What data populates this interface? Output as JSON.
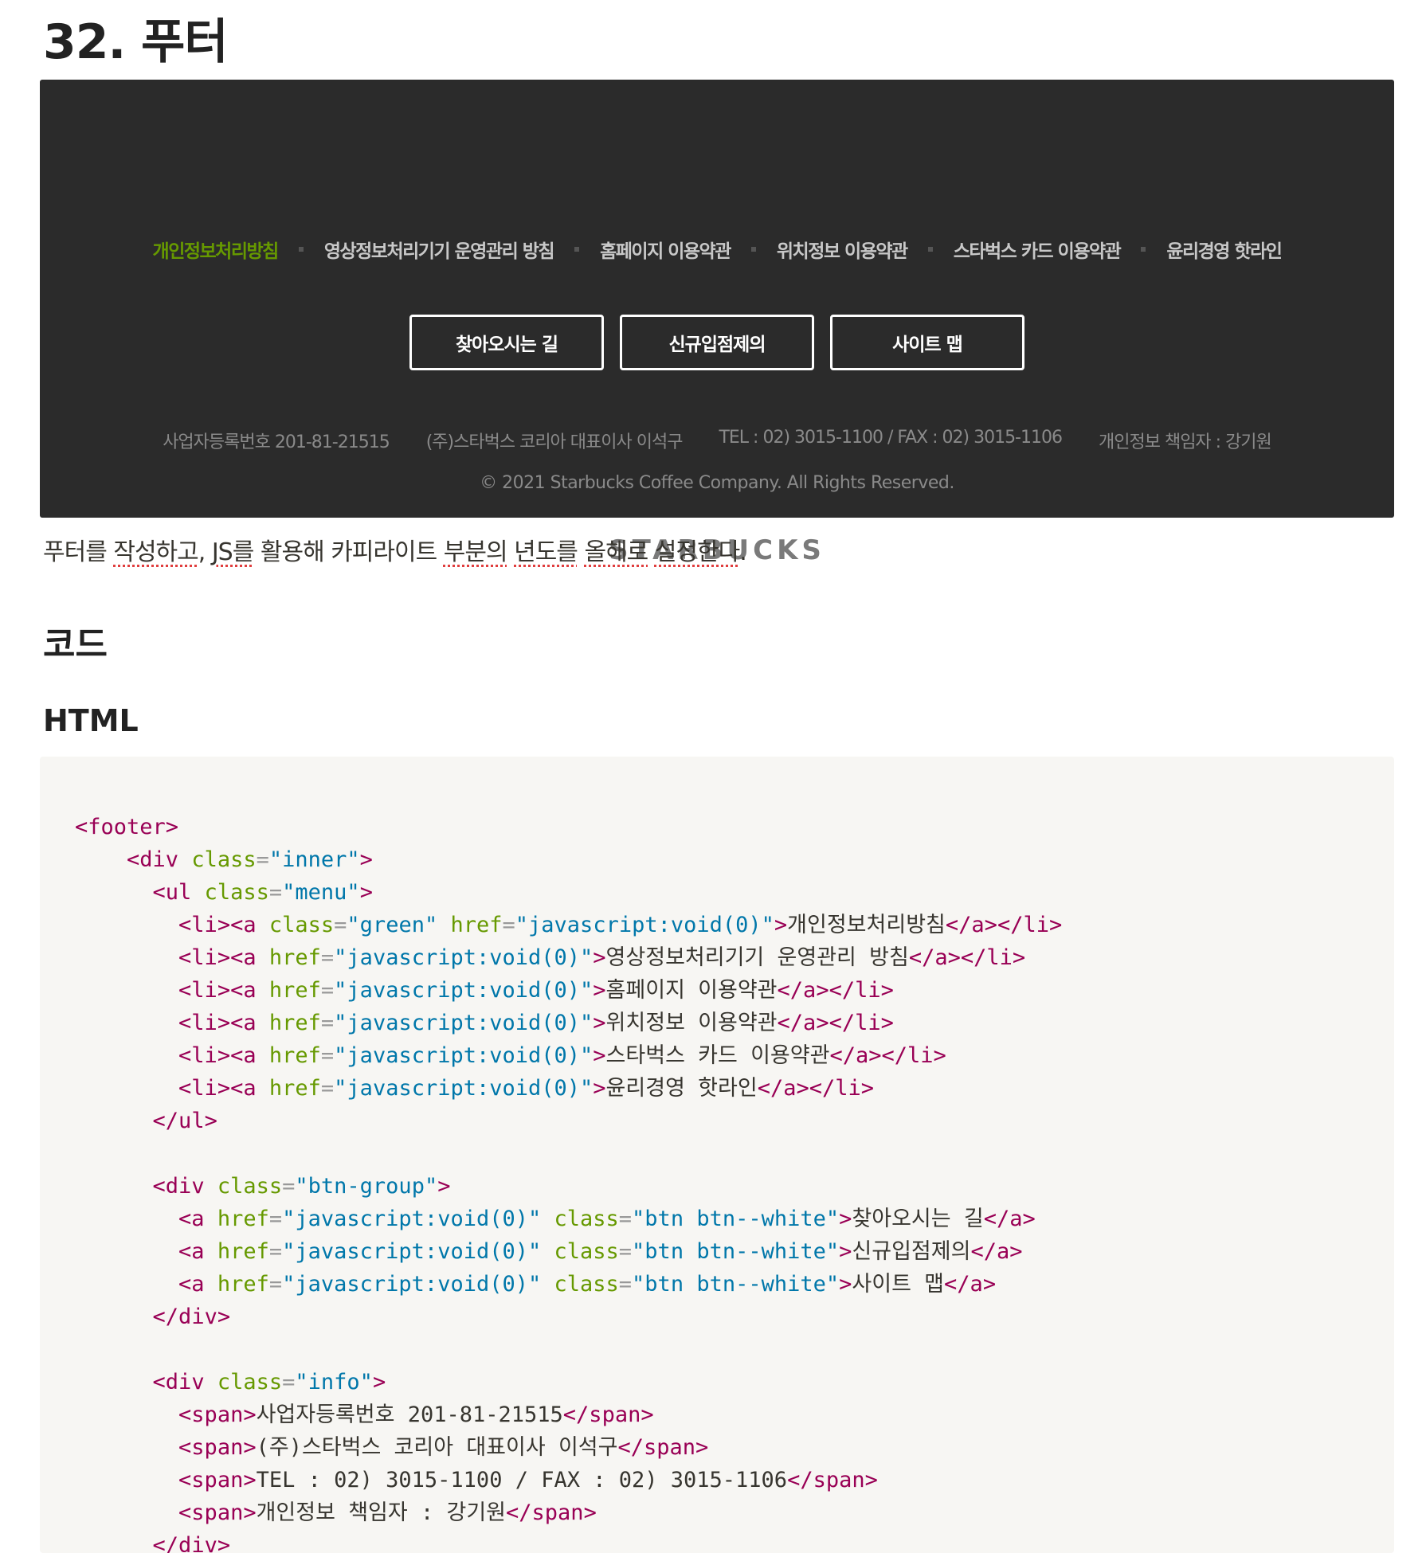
{
  "heading": "32. 푸터",
  "footer_preview": {
    "menu": [
      {
        "label": "개인정보처리방침",
        "green": true
      },
      {
        "label": "영상정보처리기기 운영관리 방침"
      },
      {
        "label": "홈페이지 이용약관"
      },
      {
        "label": "위치정보 이용약관"
      },
      {
        "label": "스타벅스 카드 이용약관"
      },
      {
        "label": "윤리경영 핫라인"
      }
    ],
    "buttons": [
      "찾아오시는 길",
      "신규입점제의",
      "사이트 맵"
    ],
    "info": [
      "사업자등록번호 201-81-21515",
      "(주)스타벅스 코리아 대표이사 이석구",
      "TEL : 02) 3015-1100 / FAX : 02) 3015-1106",
      "개인정보 책임자 : 강기원"
    ],
    "copyright": "© 2021 Starbucks Coffee Company. All Rights Reserved.",
    "logo": "STARBUCKS",
    "colors": {
      "background": "#2b2b2b",
      "green": "#669900"
    }
  },
  "description": {
    "parts": [
      "푸터를 ",
      "작성하고",
      ", ",
      "JS를",
      " 활용해 카피라이트 ",
      "부분의",
      " ",
      "년도를",
      " ",
      "올해로",
      " ",
      "설정한다",
      "."
    ]
  },
  "section_title": "코드",
  "subsection_title": "HTML",
  "code": {
    "lines": [
      "<footer>",
      "    <div class=\"inner\">",
      "      <ul class=\"menu\">",
      "        <li><a class=\"green\" href=\"javascript:void(0)\">개인정보처리방침</a></li>",
      "        <li><a href=\"javascript:void(0)\">영상정보처리기기 운영관리 방침</a></li>",
      "        <li><a href=\"javascript:void(0)\">홈페이지 이용약관</a></li>",
      "        <li><a href=\"javascript:void(0)\">위치정보 이용약관</a></li>",
      "        <li><a href=\"javascript:void(0)\">스타벅스 카드 이용약관</a></li>",
      "        <li><a href=\"javascript:void(0)\">윤리경영 핫라인</a></li>",
      "      </ul>",
      "",
      "      <div class=\"btn-group\">",
      "        <a href=\"javascript:void(0)\" class=\"btn btn--white\">찾아오시는 길</a>",
      "        <a href=\"javascript:void(0)\" class=\"btn btn--white\">신규입점제의</a>",
      "        <a href=\"javascript:void(0)\" class=\"btn btn--white\">사이트 맵</a>",
      "      </div>",
      "",
      "      <div class=\"info\">",
      "        <span>사업자등록번호 201-81-21515</span>",
      "        <span>(주)스타벅스 코리아 대표이사 이석구</span>",
      "        <span>TEL : 02) 3015-1100 / FAX : 02) 3015-1106</span>",
      "        <span>개인정보 책임자 : 강기원</span>",
      "      </div>"
    ]
  }
}
